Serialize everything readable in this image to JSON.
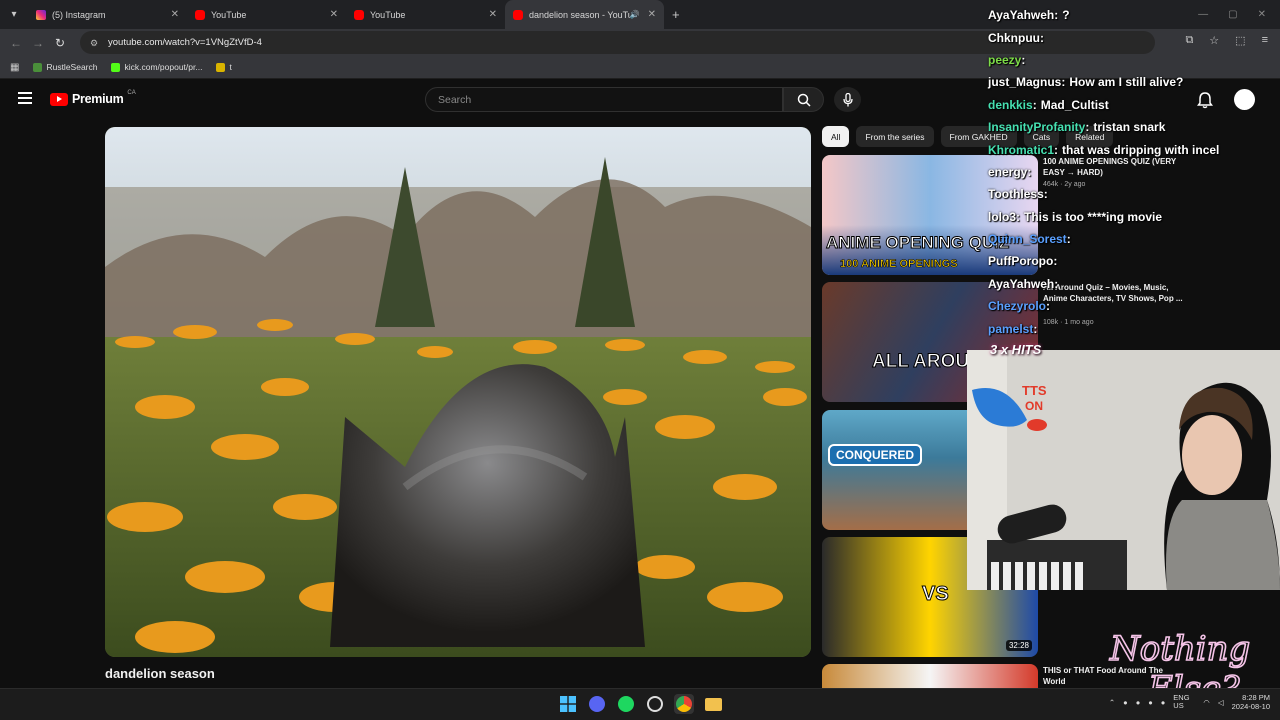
{
  "browser": {
    "tabs": [
      {
        "title": "(5) Instagram",
        "favicon": "instagram",
        "active": false
      },
      {
        "title": "YouTube",
        "favicon": "youtube",
        "active": false
      },
      {
        "title": "YouTube",
        "favicon": "youtube",
        "active": false
      },
      {
        "title": "dandelion season - YouTube",
        "favicon": "youtube",
        "active": true
      }
    ],
    "url": "youtube.com/watch?v=1VNgZtVfD-4",
    "bookmarks": [
      {
        "label": "RustleSearch"
      },
      {
        "label": "kick.com/popout/pr..."
      },
      {
        "label": "t"
      }
    ]
  },
  "youtube": {
    "logo_text": "Premium",
    "logo_region": "CA",
    "search_placeholder": "Search",
    "video_title": "dandelion season",
    "chips": [
      "All",
      "From the series",
      "From GAKHED",
      "Cats",
      "Related"
    ],
    "recommendations": [
      {
        "title": "100 ANIME OPENINGS QUIZ (VERY EASY → HARD)",
        "meta": "464k · 2y ago",
        "thumb_text": "ANIME OPENING QUIZ",
        "thumb_sub": "100 ANIME OPENINGS",
        "duration": ""
      },
      {
        "title": "All Around Quiz – Movies, Music, Anime Characters, TV Shows, Pop ...",
        "meta": "108k · 1 mo ago",
        "thumb_text": "ALL AROUND QUIZ",
        "duration": ""
      },
      {
        "title": "",
        "meta": "",
        "thumb_text": "CONQUERED",
        "duration": ""
      },
      {
        "title": "",
        "meta": "",
        "thumb_text": "VS",
        "duration": "32:28"
      },
      {
        "title": "THIS or THAT Food Around The World",
        "meta": "",
        "thumb_text": "",
        "duration": ""
      }
    ]
  },
  "chat": [
    {
      "user": "AyaYahweh",
      "color": "#ffffff",
      "text": "?"
    },
    {
      "user": "Chknpuu",
      "color": "#ffffff",
      "text": ""
    },
    {
      "user": "peezy",
      "color": "#7ddc48",
      "text": ""
    },
    {
      "user": "just_Magnus",
      "color": "#ffffff",
      "text": "How am I still alive?"
    },
    {
      "user": "denkkis",
      "color": "#46e0b1",
      "text": "Mad_Cultist"
    },
    {
      "user": "InsanityProfanity",
      "color": "#46e0b1",
      "text": "tristan snark"
    },
    {
      "user": "Khromatic1",
      "color": "#46e0b1",
      "text": "that was dripping with incel"
    },
    {
      "user": "energy",
      "color": "#ffffff",
      "text": ""
    },
    {
      "user": "Toothless",
      "color": "#ffffff",
      "text": ""
    },
    {
      "user": "lolo3",
      "color": "#ffffff",
      "text": "This is too ****ing movie"
    },
    {
      "user": "Quinn_Sorest",
      "color": "#5aa0ff",
      "text": ""
    },
    {
      "user": "PuffPoropo",
      "color": "#ffffff",
      "text": ""
    },
    {
      "user": "AyaYahweh",
      "color": "#ffffff",
      "text": ""
    },
    {
      "user": "Chezyrolo",
      "color": "#5aa0ff",
      "text": ""
    },
    {
      "user": "pamelst",
      "color": "#5aa0ff",
      "text": ""
    }
  ],
  "hits": "3 x HITS",
  "tts": "TTS ON",
  "overlay_logo": "Nothing Else?",
  "taskbar": {
    "lang": "ENG US",
    "time": "8:28 PM",
    "date": "2024-08-10"
  }
}
